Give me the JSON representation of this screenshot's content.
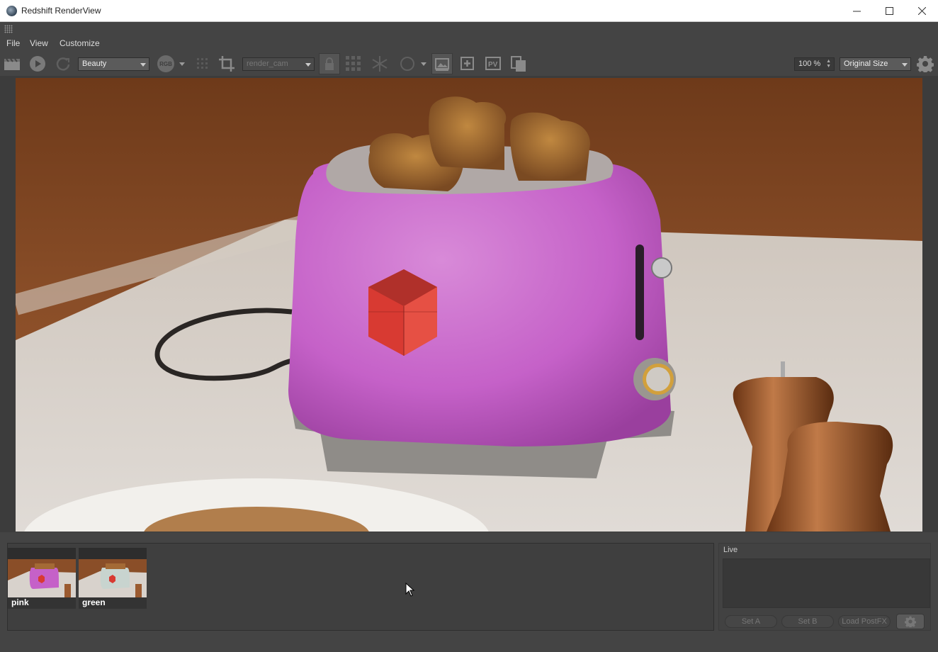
{
  "window": {
    "title": "Redshift RenderView"
  },
  "menu": {
    "items": [
      "File",
      "View",
      "Customize"
    ]
  },
  "toolbar": {
    "aov_select": "Beauty",
    "channel_badge": "RGB",
    "camera_select": "render_cam",
    "zoom_value": "100 %",
    "size_select": "Original Size",
    "icons": [
      "clapper-icon",
      "play-icon",
      "refresh-icon",
      "rgb-channel-icon",
      "grid-icon",
      "crop-icon",
      "lock-icon",
      "bucket-grid-icon",
      "freeze-icon",
      "circle-icon",
      "save-image-icon",
      "add-snapshot-icon",
      "pv-icon",
      "copy-icon",
      "gear-icon"
    ]
  },
  "snapshots": [
    {
      "label": "pink",
      "accent": "#b85cc0"
    },
    {
      "label": "green",
      "accent": "#c8d4cf"
    }
  ],
  "live": {
    "label": "Live",
    "buttons": [
      "Set A",
      "Set B",
      "Load PostFX"
    ]
  },
  "colors": {
    "toaster": "#c561c8",
    "wall": "#8a4a24",
    "counter": "#d8d2cc",
    "logo": "#d83a32",
    "pepper_mill": "#9b5a30"
  }
}
